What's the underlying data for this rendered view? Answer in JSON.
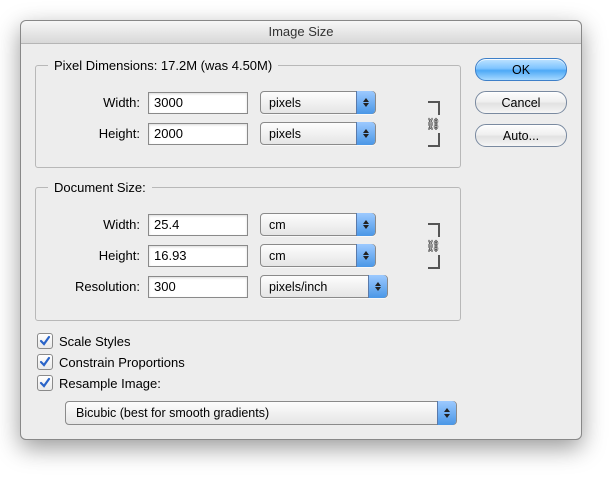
{
  "title": "Image Size",
  "buttons": {
    "ok": "OK",
    "cancel": "Cancel",
    "auto": "Auto..."
  },
  "pixelDimensions": {
    "legend": "Pixel Dimensions:  17.2M (was 4.50M)",
    "widthLabel": "Width:",
    "width": "3000",
    "widthUnit": "pixels",
    "heightLabel": "Height:",
    "height": "2000",
    "heightUnit": "pixels"
  },
  "documentSize": {
    "legend": "Document Size:",
    "widthLabel": "Width:",
    "width": "25.4",
    "widthUnit": "cm",
    "heightLabel": "Height:",
    "height": "16.93",
    "heightUnit": "cm",
    "resolutionLabel": "Resolution:",
    "resolution": "300",
    "resolutionUnit": "pixels/inch"
  },
  "checks": {
    "scaleStyles": "Scale Styles",
    "constrain": "Constrain Proportions",
    "resample": "Resample Image:"
  },
  "resampleMethod": "Bicubic (best for smooth gradients)"
}
